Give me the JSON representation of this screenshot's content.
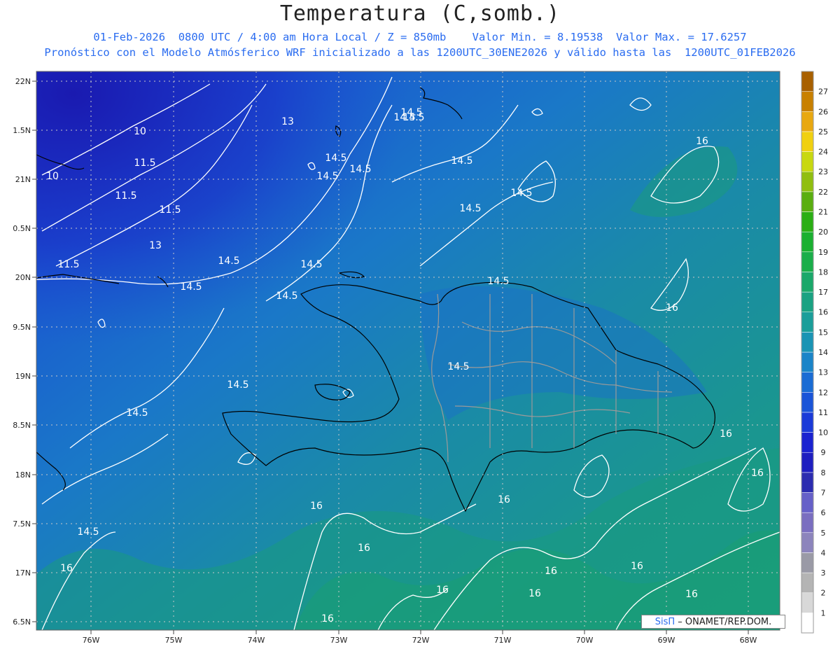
{
  "title": "Temperatura (C,somb.)",
  "subtitle1": "01-Feb-2026  0800 UTC / 4:00 am Hora Local / Z = 850mb    Valor Min. = 8.19538  Valor Max. = 17.6257",
  "subtitle2": "Pronóstico con el Modelo Atmósferico WRF inicializado a las 1200UTC_30ENE2026 y válido hasta las  1200UTC_01FEB2026",
  "credit": {
    "sis": "SisΠ",
    "rest": "– ONAMET/REP.DOM."
  },
  "lat_labels": [
    "22N",
    "1.5N",
    "21N",
    "0.5N",
    "20N",
    "9.5N",
    "19N",
    "8.5N",
    "18N",
    "7.5N",
    "17N",
    "6.5N"
  ],
  "lon_labels": [
    "76W",
    "75W",
    "74W",
    "73W",
    "72W",
    "71W",
    "70W",
    "69W",
    "68W"
  ],
  "colorbar": {
    "levels": [
      "1",
      "2",
      "3",
      "4",
      "5",
      "6",
      "7",
      "8",
      "9",
      "10",
      "11",
      "12",
      "13",
      "14",
      "15",
      "16",
      "17",
      "18",
      "19",
      "20",
      "21",
      "22",
      "23",
      "24",
      "25",
      "26",
      "27"
    ],
    "colors": [
      "#ffffff",
      "#d8d8d8",
      "#b4b4b4",
      "#9a9aa6",
      "#8c84bc",
      "#7a6ec0",
      "#6660c8",
      "#2c2cb0",
      "#1e1ec0",
      "#1a22d0",
      "#1a3ad8",
      "#1a54d8",
      "#1a6cd4",
      "#1a84c8",
      "#1a94b4",
      "#1a9e9a",
      "#1aa282",
      "#1aa86a",
      "#1aae4a",
      "#1ab030",
      "#2aae14",
      "#5aae10",
      "#90be10",
      "#c8d810",
      "#f0d010",
      "#e8a810",
      "#c88000",
      "#a86000"
    ]
  },
  "contour_labels": [
    "10",
    "10",
    "11.5",
    "11.5",
    "11.5",
    "11.5",
    "13",
    "13",
    "14.5",
    "14.5",
    "14.5",
    "14.5",
    "14.5",
    "14.5",
    "14.5",
    "14.5",
    "14.5",
    "14.5",
    "14.5",
    "14.5",
    "14.5",
    "14.5",
    "14.5",
    "14.5",
    "14.5",
    "14.5",
    "16",
    "16",
    "16",
    "16",
    "16",
    "16",
    "16",
    "16",
    "16",
    "16",
    "16",
    "16",
    "16",
    "16"
  ]
}
